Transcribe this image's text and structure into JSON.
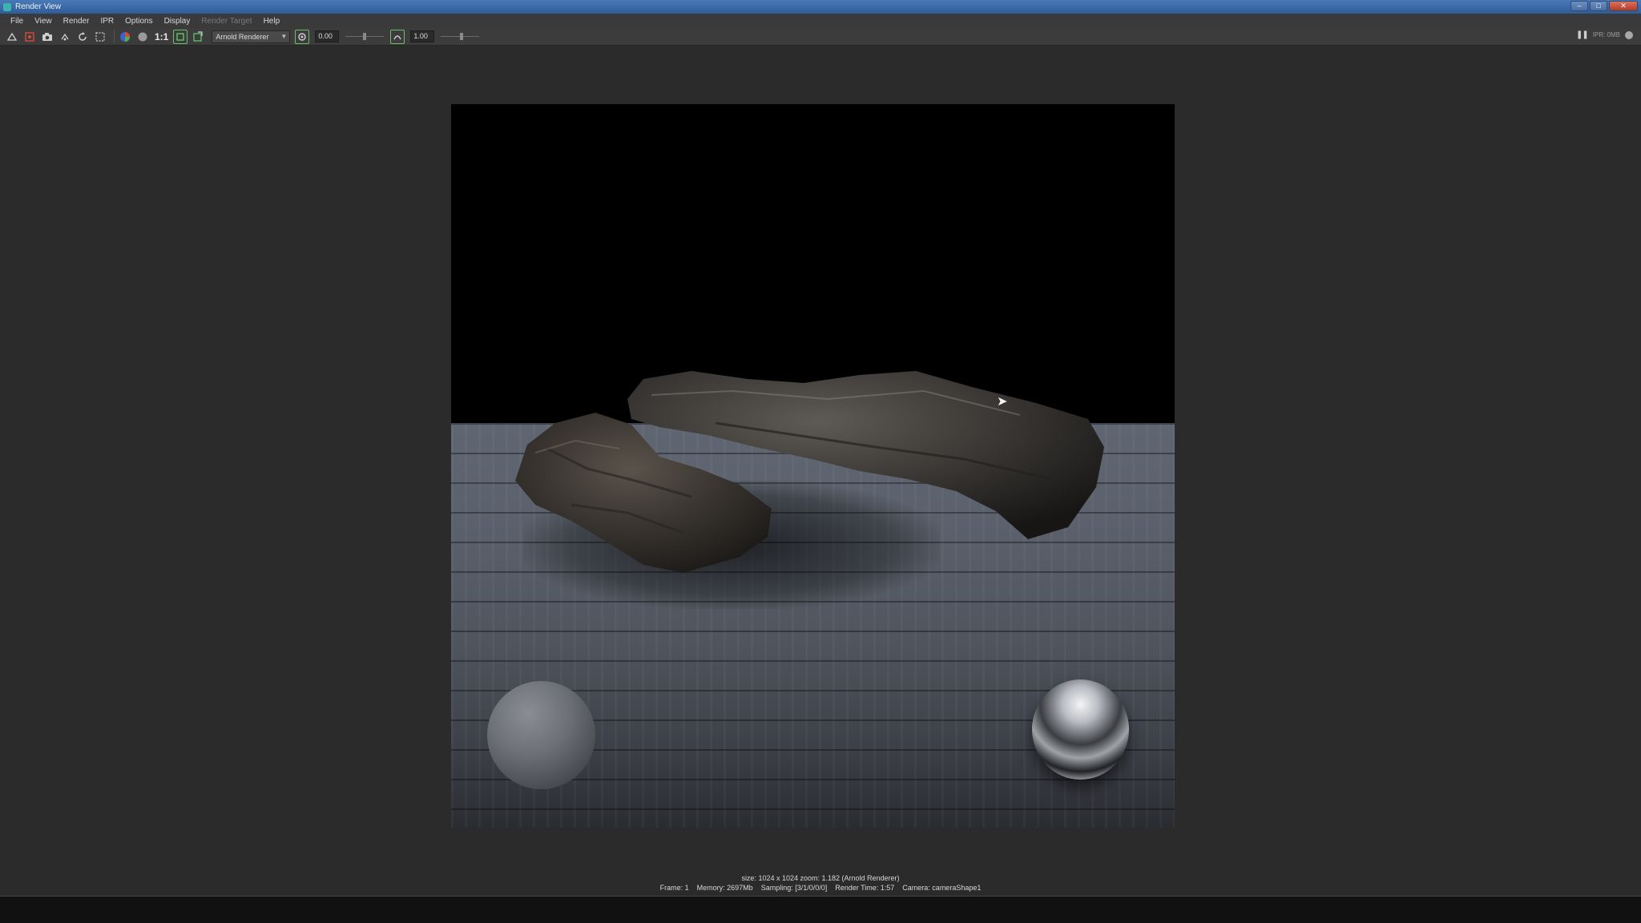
{
  "window": {
    "title": "Render View",
    "controls": {
      "minimize": "–",
      "maximize": "□",
      "close": "✕"
    }
  },
  "menu": {
    "items": [
      "File",
      "View",
      "Render",
      "IPR",
      "Options",
      "Display",
      "Render Target",
      "Help"
    ]
  },
  "toolbar": {
    "ratio_label": "1:1",
    "renderer": "Arnold Renderer",
    "exposure_value": "0.00",
    "exposure_level": 0.5,
    "gamma_value": "1.00",
    "gamma_level": 0.55,
    "ipr_status": "IPR: 0MB"
  },
  "render_info": {
    "line1": "size: 1024 x 1024 zoom: 1.182    (Arnold Renderer)",
    "frame": "Frame: 1",
    "memory": "Memory: 2697Mb",
    "sampling": "Sampling: [3/1/0/0/0]",
    "render_time": "Render Time: 1:57",
    "camera": "Camera: cameraShape1"
  },
  "colors": {
    "viewport_bg": "#2b2b2b",
    "titlebar": "#3b6aa8",
    "accent_green": "#5fd06a"
  }
}
